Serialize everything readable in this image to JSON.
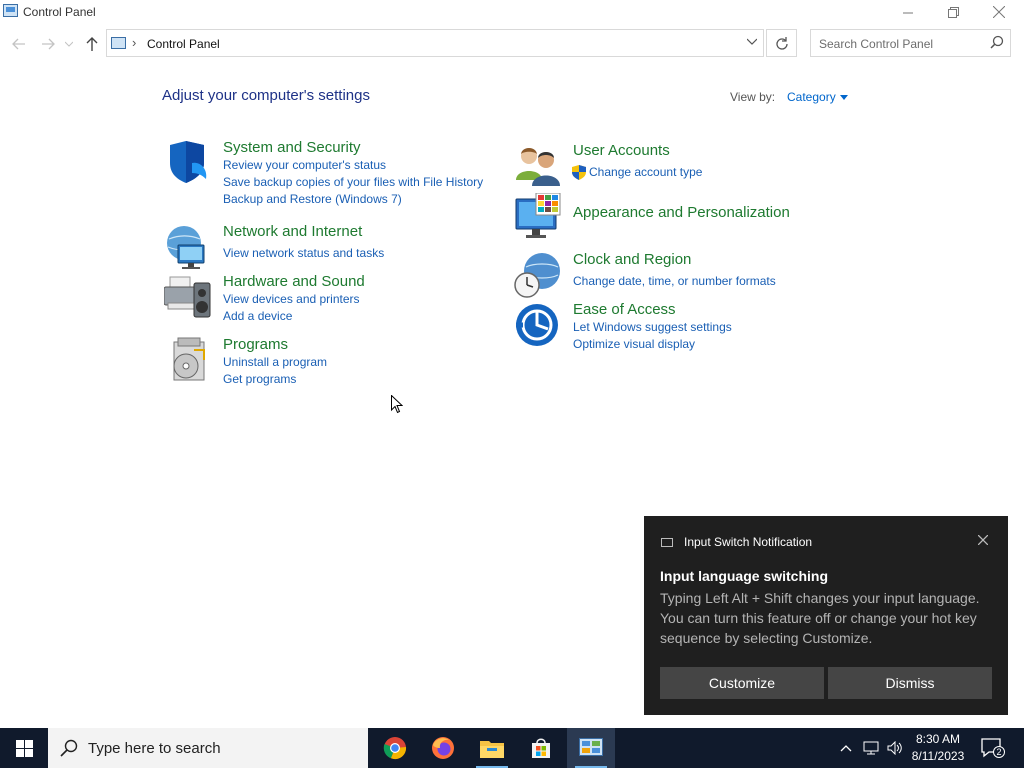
{
  "window": {
    "title": "Control Panel",
    "minimize_icon": "minimize-icon",
    "maximize_icon": "restore-icon",
    "close_icon": "close-icon"
  },
  "address_bar": {
    "breadcrumb": "Control Panel",
    "separator": "›",
    "search_placeholder": "Search Control Panel"
  },
  "main": {
    "heading": "Adjust your computer's settings",
    "view_by_label": "View by:",
    "view_by_value": "Category",
    "categories": [
      {
        "title": "System and Security",
        "icon": "shield-icon",
        "links": [
          "Review your computer's status",
          "Save backup copies of your files with File History",
          "Backup and Restore (Windows 7)"
        ]
      },
      {
        "title": "Network and Internet",
        "icon": "globe-network-icon",
        "links": [
          "View network status and tasks"
        ]
      },
      {
        "title": "Hardware and Sound",
        "icon": "printer-speaker-icon",
        "links": [
          "View devices and printers",
          "Add a device"
        ]
      },
      {
        "title": "Programs",
        "icon": "programs-disc-icon",
        "links": [
          "Uninstall a program",
          "Get programs"
        ]
      },
      {
        "title": "User Accounts",
        "icon": "users-icon",
        "links": [
          "Change account type"
        ]
      },
      {
        "title": "Appearance and Personalization",
        "icon": "monitor-palette-icon",
        "links": []
      },
      {
        "title": "Clock and Region",
        "icon": "clock-globe-icon",
        "links": [
          "Change date, time, or number formats"
        ]
      },
      {
        "title": "Ease of Access",
        "icon": "ease-of-access-icon",
        "links": [
          "Let Windows suggest settings",
          "Optimize visual display"
        ]
      }
    ]
  },
  "notification": {
    "header": "Input Switch Notification",
    "title": "Input language switching",
    "body": "Typing Left Alt + Shift changes your input language. You can turn this feature off or change your hot key sequence by selecting Customize.",
    "customize_label": "Customize",
    "dismiss_label": "Dismiss"
  },
  "taskbar": {
    "search_placeholder": "Type here to search",
    "apps": [
      "chrome-icon",
      "firefox-icon",
      "file-explorer-icon",
      "store-icon",
      "control-panel-icon"
    ],
    "time": "8:30 AM",
    "date": "8/11/2023",
    "notification_count": "2"
  },
  "colors": {
    "category_title": "#1e7a30",
    "link": "#1a5fb4",
    "heading": "#1e3287",
    "toast_bg": "#1f1f1f",
    "taskbar_bg": "#101a2c"
  }
}
